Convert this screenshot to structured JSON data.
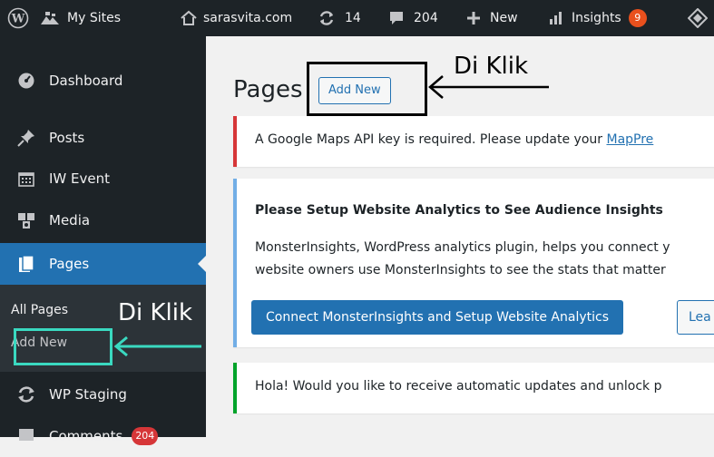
{
  "adminbar": {
    "my_sites": "My Sites",
    "site_name": "sarasvita.com",
    "updates_count": "14",
    "comments_count": "204",
    "new_label": "New",
    "insights_label": "Insights",
    "insights_badge": "9"
  },
  "sidebar": {
    "items": [
      {
        "label": "Dashboard"
      },
      {
        "label": "Posts"
      },
      {
        "label": "IW Event"
      },
      {
        "label": "Media"
      },
      {
        "label": "Pages"
      },
      {
        "label": "WP Staging"
      },
      {
        "label": "Comments",
        "badge": "204"
      }
    ],
    "submenu": {
      "all_pages": "All Pages",
      "add_new": "Add New"
    }
  },
  "annotations": {
    "top_label": "Di Klik",
    "side_label": "Di Klik"
  },
  "content": {
    "page_title": "Pages",
    "add_new_button": "Add New",
    "notice_google_maps": {
      "text": "A Google Maps API key is required. Please update your ",
      "link": "MapPre"
    },
    "notice_analytics": {
      "title": "Please Setup Website Analytics to See Audience Insights",
      "line1": "MonsterInsights, WordPress analytics plugin, helps you connect y",
      "line2": "website owners use MonsterInsights to see the stats that matter",
      "primary_button": "Connect MonsterInsights and Setup Website Analytics",
      "secondary_button": "Lea"
    },
    "notice_updates": {
      "text": "Hola! Would you like to receive automatic updates and unlock p"
    }
  },
  "colors": {
    "admin_dark": "#1d2327",
    "wp_blue": "#2271b1",
    "highlight_cyan": "#3ad9c0",
    "notice_red": "#d63638",
    "notice_blue": "#72aee6",
    "notice_green": "#00a32a"
  }
}
